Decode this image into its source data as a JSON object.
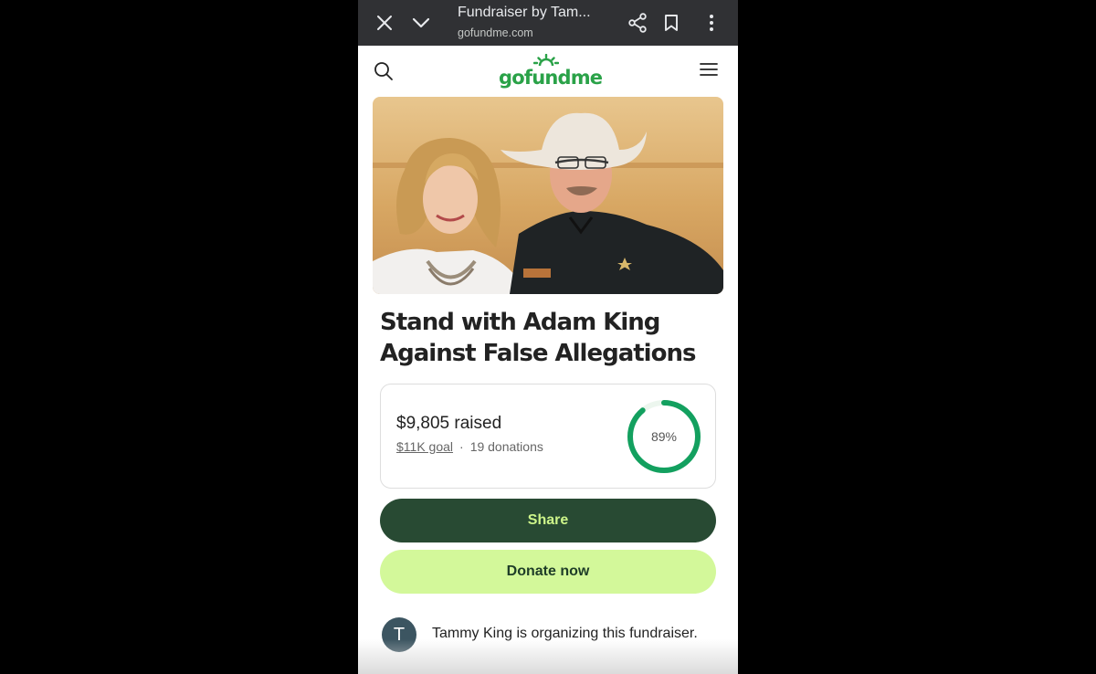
{
  "browser": {
    "tab_title": "Fundraiser by Tam...",
    "url": "gofundme.com",
    "icons": [
      "close-icon",
      "chevron-down-icon",
      "share-icon",
      "bookmark-icon",
      "more-vert-icon"
    ]
  },
  "site": {
    "logo_text": "gofundme",
    "brand_color": "#2aa248",
    "icons": [
      "search-icon",
      "hamburger-menu-icon"
    ]
  },
  "campaign": {
    "title": "Stand with Adam King Against False Allegations",
    "raised": "$9,805 raised",
    "goal": "$11K goal",
    "separator": "·",
    "donations": "19 donations",
    "progress_label": "89%",
    "progress_fraction": 0.89
  },
  "actions": {
    "share_label": "Share",
    "donate_label": "Donate now",
    "share_color": "#284a33",
    "donate_color": "#d3f89a"
  },
  "organizer": {
    "initial": "T",
    "text": "Tammy King is organizing this fundraiser."
  }
}
